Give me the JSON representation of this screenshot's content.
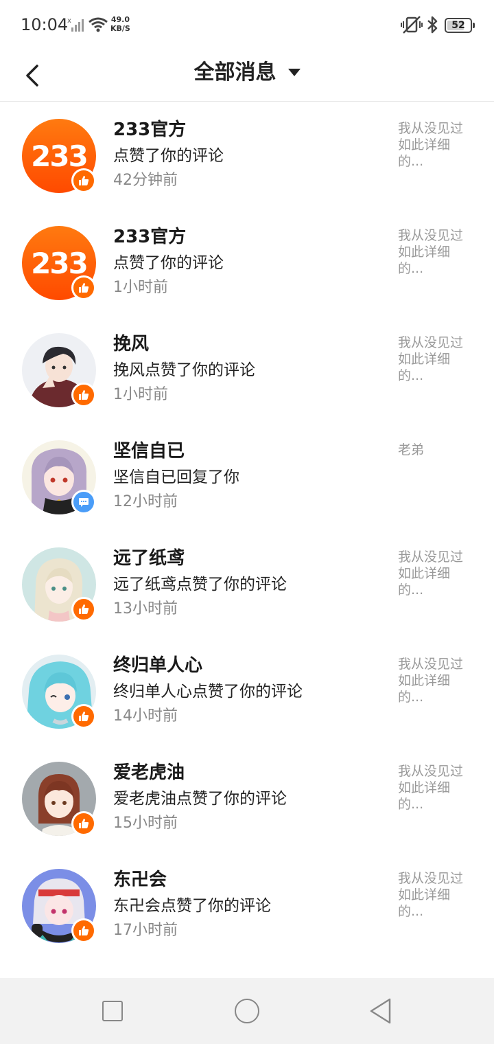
{
  "status_bar": {
    "time": "10:04",
    "speed_value": "49.0",
    "speed_unit": "KB/S",
    "battery": "52"
  },
  "header": {
    "title": "全部消息"
  },
  "messages": [
    {
      "name": "233官方",
      "action": "点赞了你的评论",
      "time": "42分钟前",
      "preview": "我从没见过如此详细的...",
      "badge": "like",
      "avatar": "233-logo"
    },
    {
      "name": "233官方",
      "action": "点赞了你的评论",
      "time": "1小时前",
      "preview": "我从没见过如此详细的...",
      "badge": "like",
      "avatar": "233-logo"
    },
    {
      "name": "挽风",
      "action": "挽风点赞了你的评论",
      "time": "1小时前",
      "preview": "我从没见过如此详细的...",
      "badge": "like",
      "avatar": "anime-boy"
    },
    {
      "name": "坚信自已",
      "action": "坚信自已回复了你",
      "time": "12小时前",
      "preview": "老弟",
      "badge": "comment",
      "avatar": "anime-girl-purple"
    },
    {
      "name": "远了纸鸢",
      "action": "远了纸鸢点赞了你的评论",
      "time": "13小时前",
      "preview": "我从没见过如此详细的...",
      "badge": "like",
      "avatar": "anime-girl-light"
    },
    {
      "name": "终归单人心",
      "action": "终归单人心点赞了你的评论",
      "time": "14小时前",
      "preview": "我从没见过如此详细的...",
      "badge": "like",
      "avatar": "anime-girl-cyan"
    },
    {
      "name": "爱老虎油",
      "action": "爱老虎油点赞了你的评论",
      "time": "15小时前",
      "preview": "我从没见过如此详细的...",
      "badge": "like",
      "avatar": "anime-girl-brown"
    },
    {
      "name": "东卍会",
      "action": "东卍会点赞了你的评论",
      "time": "17小时前",
      "preview": "我从没见过如此详细的...",
      "badge": "like",
      "avatar": "anime-girl-headphones"
    }
  ],
  "colors": {
    "like_badge": "#ff6a00",
    "comment_badge": "#4a9df8",
    "logo_orange": "#ff5a00"
  },
  "icons": {
    "back": "chevron-left-icon",
    "dropdown": "caret-down-icon",
    "like": "thumbs-up-icon",
    "comment": "chat-bubble-icon"
  }
}
